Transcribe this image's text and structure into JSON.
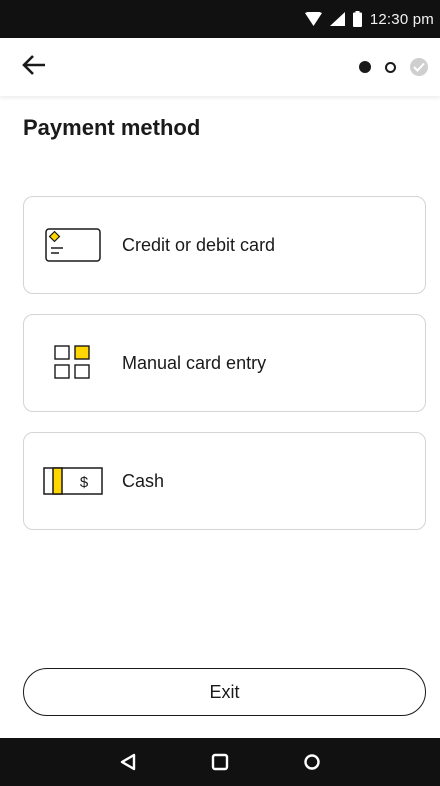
{
  "status_bar": {
    "time": "12:30 pm",
    "icons": [
      "wifi-icon",
      "cellular-signal-icon",
      "battery-icon"
    ]
  },
  "header": {
    "back_icon": "arrow-left-icon",
    "steps": [
      "current",
      "upcoming",
      "complete"
    ]
  },
  "page": {
    "title": "Payment method"
  },
  "options": [
    {
      "label": "Credit or debit card",
      "icon": "credit-card-icon"
    },
    {
      "label": "Manual card entry",
      "icon": "grid-keypad-icon"
    },
    {
      "label": "Cash",
      "icon": "cash-icon"
    }
  ],
  "footer": {
    "exit_label": "Exit"
  },
  "nav": {
    "icons": [
      "back-triangle-icon",
      "home-square-icon",
      "recents-circle-icon"
    ]
  },
  "colors": {
    "accent": "#ffd600",
    "text": "#1a1a1a",
    "border": "#d4d4d4",
    "system_bar": "#111111"
  }
}
